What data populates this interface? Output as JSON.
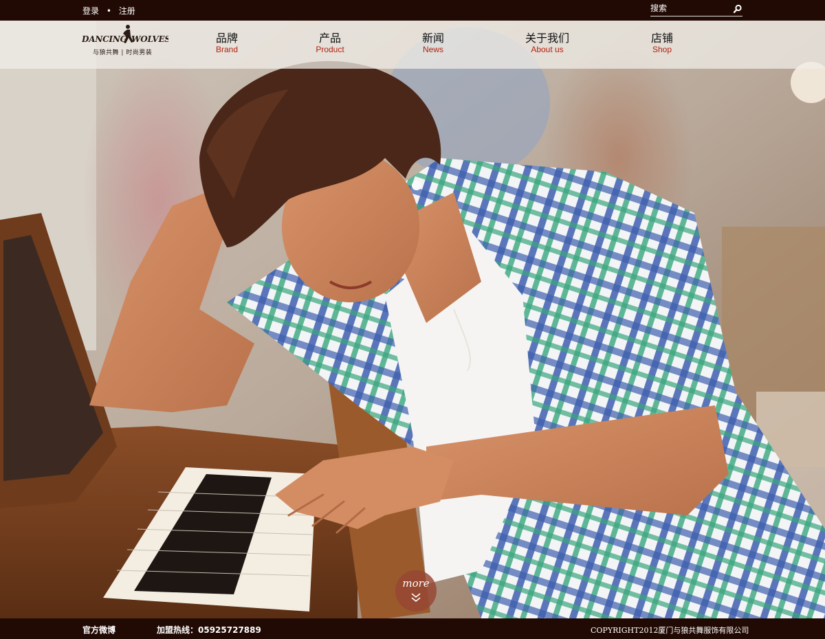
{
  "topbar": {
    "login_label": "登录",
    "separator": "•",
    "register_label": "注册",
    "search_placeholder": "搜索",
    "search_icon": "search-icon"
  },
  "logo": {
    "brand_text": "Dancing Wolves",
    "sub_text": "与狼共舞 | 时尚男装"
  },
  "nav": {
    "items": [
      {
        "cn": "品牌",
        "en": "Brand"
      },
      {
        "cn": "产品",
        "en": "Product"
      },
      {
        "cn": "新闻",
        "en": "News"
      },
      {
        "cn": "关于我们",
        "en": "About us"
      },
      {
        "cn": "店铺",
        "en": "Shop"
      }
    ]
  },
  "hero": {
    "more_label": "more",
    "more_icon": "chevron-down-icon"
  },
  "footer": {
    "weibo_label": "官方微博",
    "hotline_label": "加盟热线：05925727889",
    "copyright": "COPYRIGHT2012厦门与狼共舞服饰有限公司"
  },
  "colors": {
    "bar_bg": "#220a04",
    "nav_en": "#b3200f",
    "more_bg": "#96463288"
  }
}
